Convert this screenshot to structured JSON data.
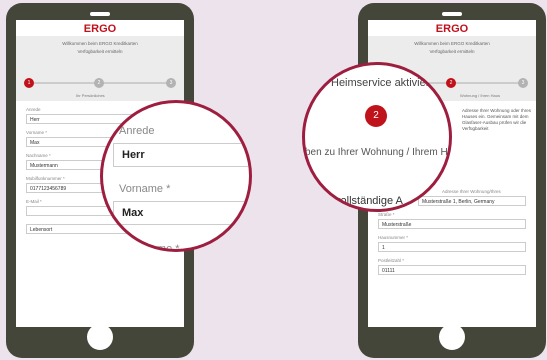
{
  "brand": {
    "name": "ERGO",
    "color": "#c0121b"
  },
  "left": {
    "banner_line1": "Willkommen beim ERGO Kreditkarten",
    "banner_line2": "Verfügbarkeit ermitteln",
    "steps": [
      "1",
      "2",
      "3"
    ],
    "step_label": "Ihr Persönliches",
    "fields": [
      {
        "label": "Anrede",
        "value": "Herr"
      },
      {
        "label": "Vorname *",
        "value": "Max"
      },
      {
        "label": "Nachname *",
        "value": "Mustermann"
      },
      {
        "label": "Mobilfunknummer *",
        "value": "0177123456789"
      },
      {
        "label": "E-Mail *",
        "value": ""
      },
      {
        "label": "",
        "value": "Lebensort"
      }
    ],
    "zoom": {
      "label1": "Anrede",
      "value1": "Herr",
      "label2": "Vorname *",
      "value2": "Max",
      "label3": "Nachname *"
    }
  },
  "right": {
    "banner_line1": "Willkommen beim ERGO Kreditkarten",
    "banner_line2": "Verfügbarkeit ermitteln",
    "steps": [
      "1",
      "2",
      "3"
    ],
    "step_label": "Wohnung / Ihren Haus",
    "side_text": "Adresse Ihrer Wohnung oder Ihres Hauses ein. Gemeinsam mit dem Glasfaser-Ausbau prüfen wir die Verfügbarkeit",
    "fields": [
      {
        "label": "Adresse Ihrer Wohnung/Ihres",
        "value": "Musterstraße 1, Berlin, Germany"
      },
      {
        "label": "Straße *",
        "value": "Musterstraße"
      },
      {
        "label": "Hausnummer *",
        "value": "1"
      },
      {
        "label": "Postleitzahl *",
        "value": "01111"
      }
    ],
    "zoom": {
      "title": "Heimservice aktiviert",
      "step": "2",
      "subtitle": "ben zu Ihrer Wohnung / Ihrem H",
      "bottom": "Ihre vollständige A"
    }
  }
}
